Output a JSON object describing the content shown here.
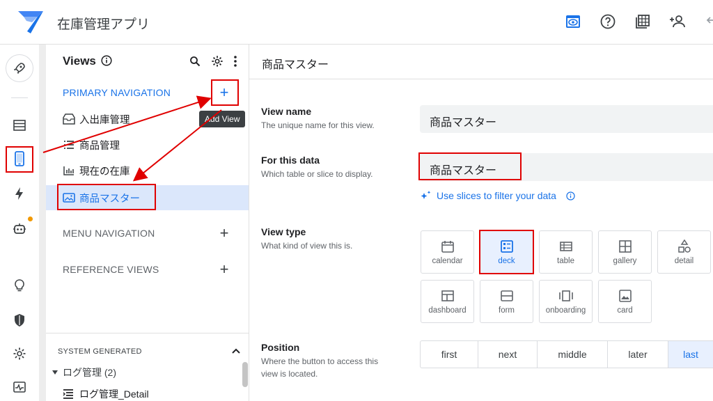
{
  "app": {
    "title": "在庫管理アプリ"
  },
  "views_panel": {
    "header": "Views",
    "primary_section": "PRIMARY NAVIGATION",
    "add_view_tooltip": "Add View",
    "primary_items": [
      {
        "label": "入出庫管理",
        "icon": "inbox-icon"
      },
      {
        "label": "商品管理",
        "icon": "list-icon"
      },
      {
        "label": "現在の在庫",
        "icon": "bar-chart-icon"
      },
      {
        "label": "商品マスター",
        "icon": "image-icon",
        "selected": true
      }
    ],
    "menu_section": "MENU NAVIGATION",
    "reference_section": "REFERENCE VIEWS",
    "system_section": "SYSTEM GENERATED",
    "system_group": "ログ管理 (2)",
    "system_item": "ログ管理_Detail"
  },
  "editor": {
    "title": "商品マスター",
    "view_name": {
      "label": "View name",
      "desc": "The unique name for this view.",
      "value": "商品マスター"
    },
    "for_this_data": {
      "label": "For this data",
      "desc": "Which table or slice to display.",
      "value": "商品マスター"
    },
    "slice_link": "Use slices to filter your data",
    "view_type": {
      "label": "View type",
      "desc": "What kind of view this is.",
      "options": [
        "calendar",
        "deck",
        "table",
        "gallery",
        "detail",
        "dashboard",
        "form",
        "onboarding",
        "card"
      ],
      "selected": "deck"
    },
    "position": {
      "label": "Position",
      "desc": "Where the button to access this view is located.",
      "options": [
        "first",
        "next",
        "middle",
        "later",
        "last"
      ],
      "selected": "last"
    }
  },
  "colors": {
    "accent": "#1a73e8",
    "selected_bg": "#dbe7fb",
    "annotation": "#e00000"
  }
}
